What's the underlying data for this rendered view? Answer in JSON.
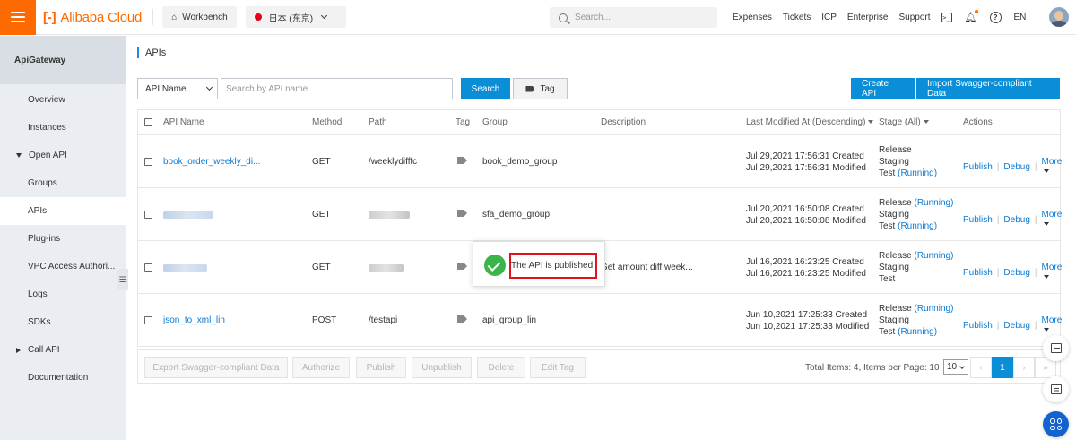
{
  "topbar": {
    "brand": "Alibaba Cloud",
    "workbench": "Workbench",
    "region": "日本 (东京)",
    "search_placeholder": "Search...",
    "nav": [
      "Expenses",
      "Tickets",
      "ICP",
      "Enterprise",
      "Support"
    ],
    "lang": "EN"
  },
  "sidebar": {
    "title": "ApiGateway",
    "items": [
      {
        "label": "Overview"
      },
      {
        "label": "Instances"
      },
      {
        "label": "Open API"
      },
      {
        "label": "Groups"
      },
      {
        "label": "APIs"
      },
      {
        "label": "Plug-ins"
      },
      {
        "label": "VPC Access Authori..."
      },
      {
        "label": "Logs"
      },
      {
        "label": "SDKs"
      },
      {
        "label": "Call API"
      },
      {
        "label": "Documentation"
      }
    ]
  },
  "main": {
    "title": "APIs",
    "filter": {
      "select_value": "API Name",
      "search_placeholder": "Search by API name",
      "search_button": "Search",
      "tag_button": "Tag"
    },
    "create_button": "Create API",
    "import_button": "Import Swagger-compliant Data",
    "columns": {
      "name": "API Name",
      "method": "Method",
      "path": "Path",
      "tag": "Tag",
      "group": "Group",
      "description": "Description",
      "modified": "Last Modified At (Descending)",
      "stage": "Stage (All)",
      "actions": "Actions"
    },
    "rows": [
      {
        "name": "book_order_weekly_di...",
        "method": "GET",
        "path": "/weeklydifffc",
        "group": "book_demo_group",
        "description": "",
        "created": "Jul 29,2021 17:56:31 Created",
        "modified": "Jul 29,2021 17:56:31 Modified",
        "stage1": "Release",
        "stage1_status": "",
        "stage2": "Staging",
        "stage3": "Test",
        "stage3_status": "(Running)"
      },
      {
        "name": "",
        "method": "GET",
        "path": "",
        "group": "sfa_demo_group",
        "description": "",
        "created": "Jul 20,2021 16:50:08 Created",
        "modified": "Jul 20,2021 16:50:08 Modified",
        "stage1": "Release",
        "stage1_status": "(Running)",
        "stage2": "Staging",
        "stage3": "Test",
        "stage3_status": "(Running)"
      },
      {
        "name": "",
        "method": "GET",
        "path": "",
        "group": "",
        "description": "Get amount diff week...",
        "created": "Jul 16,2021 16:23:25 Created",
        "modified": "Jul 16,2021 16:23:25 Modified",
        "stage1": "Release",
        "stage1_status": "(Running)",
        "stage2": "Staging",
        "stage3": "Test",
        "stage3_status": ""
      },
      {
        "name": "json_to_xml_lin",
        "method": "POST",
        "path": "/testapi",
        "group": "api_group_lin",
        "description": "",
        "created": "Jun 10,2021 17:25:33 Created",
        "modified": "Jun 10,2021 17:25:33 Modified",
        "stage1": "Release",
        "stage1_status": "(Running)",
        "stage2": "Staging",
        "stage3": "Test",
        "stage3_status": "(Running)"
      }
    ],
    "actions": {
      "publish": "Publish",
      "debug": "Debug",
      "more": "More"
    },
    "footer": {
      "buttons": [
        "Export Swagger-compliant Data",
        "Authorize",
        "Publish",
        "Unpublish",
        "Delete",
        "Edit Tag"
      ],
      "total_text": "Total Items: 4, Items per Page: 10",
      "page_size": "10",
      "current_page": "1"
    }
  },
  "toast": {
    "message": "The API is published."
  },
  "colors": {
    "brand": "#ff6a00",
    "primary": "#0a8ed7",
    "link": "#0a7ad4",
    "success": "#3bb44a",
    "highlight": "#e0121b"
  }
}
